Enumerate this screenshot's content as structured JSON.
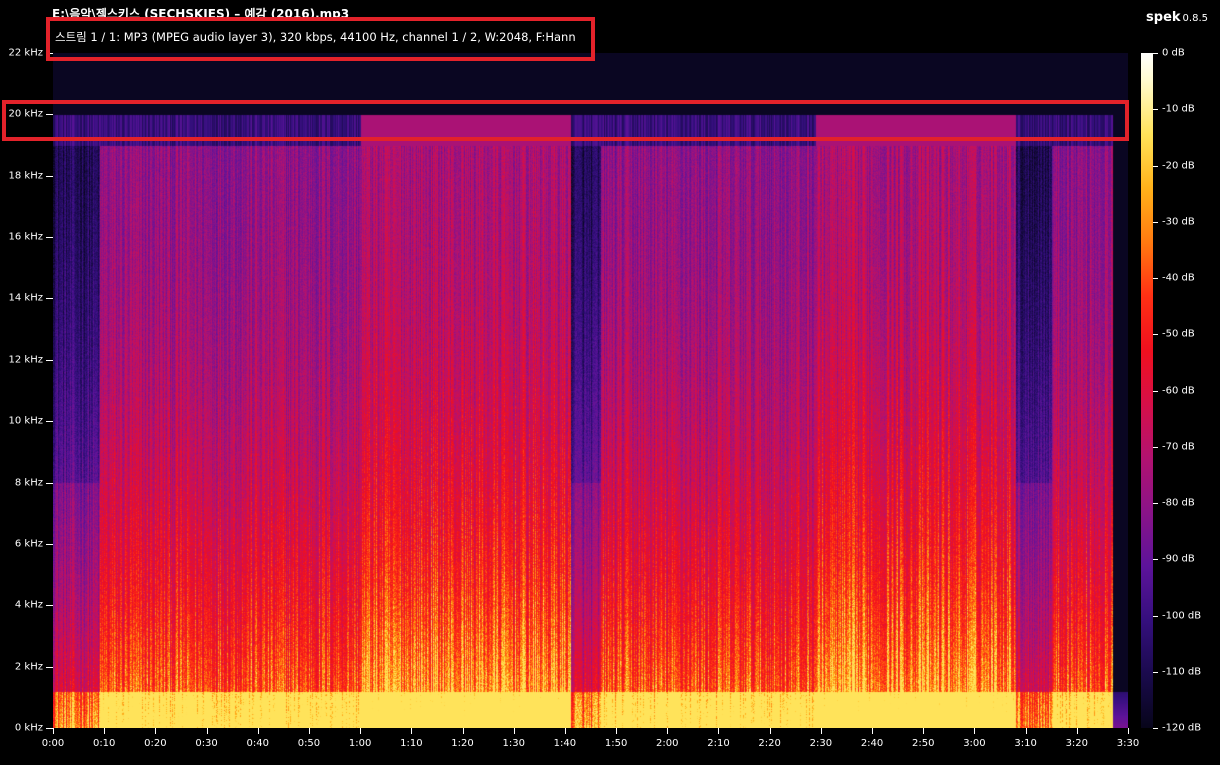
{
  "window": {
    "title": "E:\\음악\\젝스키스 (SECHSKIES) – 예감 (2016).mp3",
    "stream_info": "스트림 1 / 1: MP3 (MPEG audio layer 3), 320 kbps, 44100 Hz, channel 1 / 2, W:2048, F:Hann",
    "app_name": "spek",
    "app_version": "0.8.5"
  },
  "axes": {
    "y_ticks": [
      "22 kHz",
      "20 kHz",
      "18 kHz",
      "16 kHz",
      "14 kHz",
      "12 kHz",
      "10 kHz",
      "8 kHz",
      "6 kHz",
      "4 kHz",
      "2 kHz",
      "0 kHz"
    ],
    "x_ticks": [
      "0:00",
      "0:10",
      "0:20",
      "0:30",
      "0:40",
      "0:50",
      "1:00",
      "1:10",
      "1:20",
      "1:30",
      "1:40",
      "1:50",
      "2:00",
      "2:10",
      "2:20",
      "2:30",
      "2:40",
      "2:50",
      "3:00",
      "3:10",
      "3:20",
      "3:30"
    ],
    "colorbar_ticks": [
      "0 dB",
      "-10 dB",
      "-20 dB",
      "-30 dB",
      "-40 dB",
      "-50 dB",
      "-60 dB",
      "-70 dB",
      "-80 dB",
      "-90 dB",
      "-100 dB",
      "-110 dB",
      "-120 dB"
    ]
  },
  "chart_data": {
    "type": "heatmap",
    "x_range_seconds": [
      0,
      210
    ],
    "y_range_khz": [
      0,
      22
    ],
    "z_range_db": [
      -120,
      0
    ],
    "track_end_seconds": 207,
    "cutoff_khz": 20,
    "loud_sections_seconds": [
      [
        60,
        101
      ],
      [
        149,
        188
      ]
    ],
    "quiet_sections_seconds": [
      [
        0,
        9
      ],
      [
        101,
        107
      ],
      [
        188,
        195
      ]
    ]
  },
  "annotations": {
    "highlight_color": "#e3222a"
  }
}
